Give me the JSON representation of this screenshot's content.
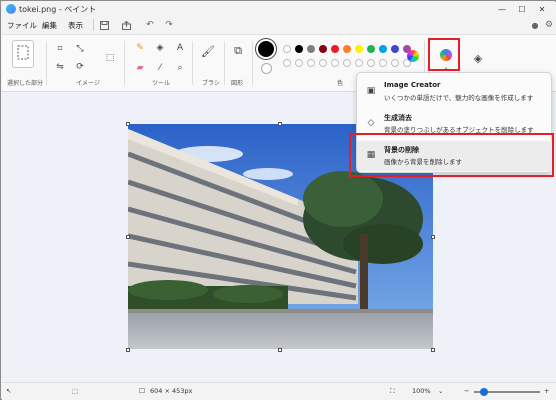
{
  "window": {
    "title": "tokei.png - ペイント"
  },
  "menu": {
    "file": "ファイル",
    "edit": "編集",
    "view": "表示"
  },
  "window_buttons": {
    "minimize": "—",
    "maximize": "☐",
    "close": "✕"
  },
  "ribbon": {
    "selection_label": "選択した部分",
    "image_label": "イメージ",
    "tools_label": "ツール",
    "brush_label": "ブラシ",
    "shapes_label": "図形",
    "colors_label": "色",
    "text_tool": "A"
  },
  "colors": {
    "row1": [
      "#ffffff",
      "#000000",
      "#7f7f7f",
      "#880015",
      "#ed1c24",
      "#ff7f27",
      "#fff200",
      "#22b14c",
      "#00a2e8",
      "#3f48cc",
      "#a349a4"
    ],
    "accent": "#e0212a"
  },
  "popup": {
    "items": [
      {
        "title": "Image Creator",
        "desc": "いくつかの単語だけで、魅力的な画像を作成します",
        "icon": "image-creator-icon"
      },
      {
        "title": "生成消去",
        "desc": "背景の塗りつぶしがあるオブジェクトを削除します",
        "icon": "generative-erase-icon"
      },
      {
        "title": "背景の削除",
        "desc": "画像から背景を削除します",
        "icon": "remove-background-icon"
      }
    ]
  },
  "status": {
    "dimensions": "604 × 453px",
    "zoom": "100%"
  }
}
